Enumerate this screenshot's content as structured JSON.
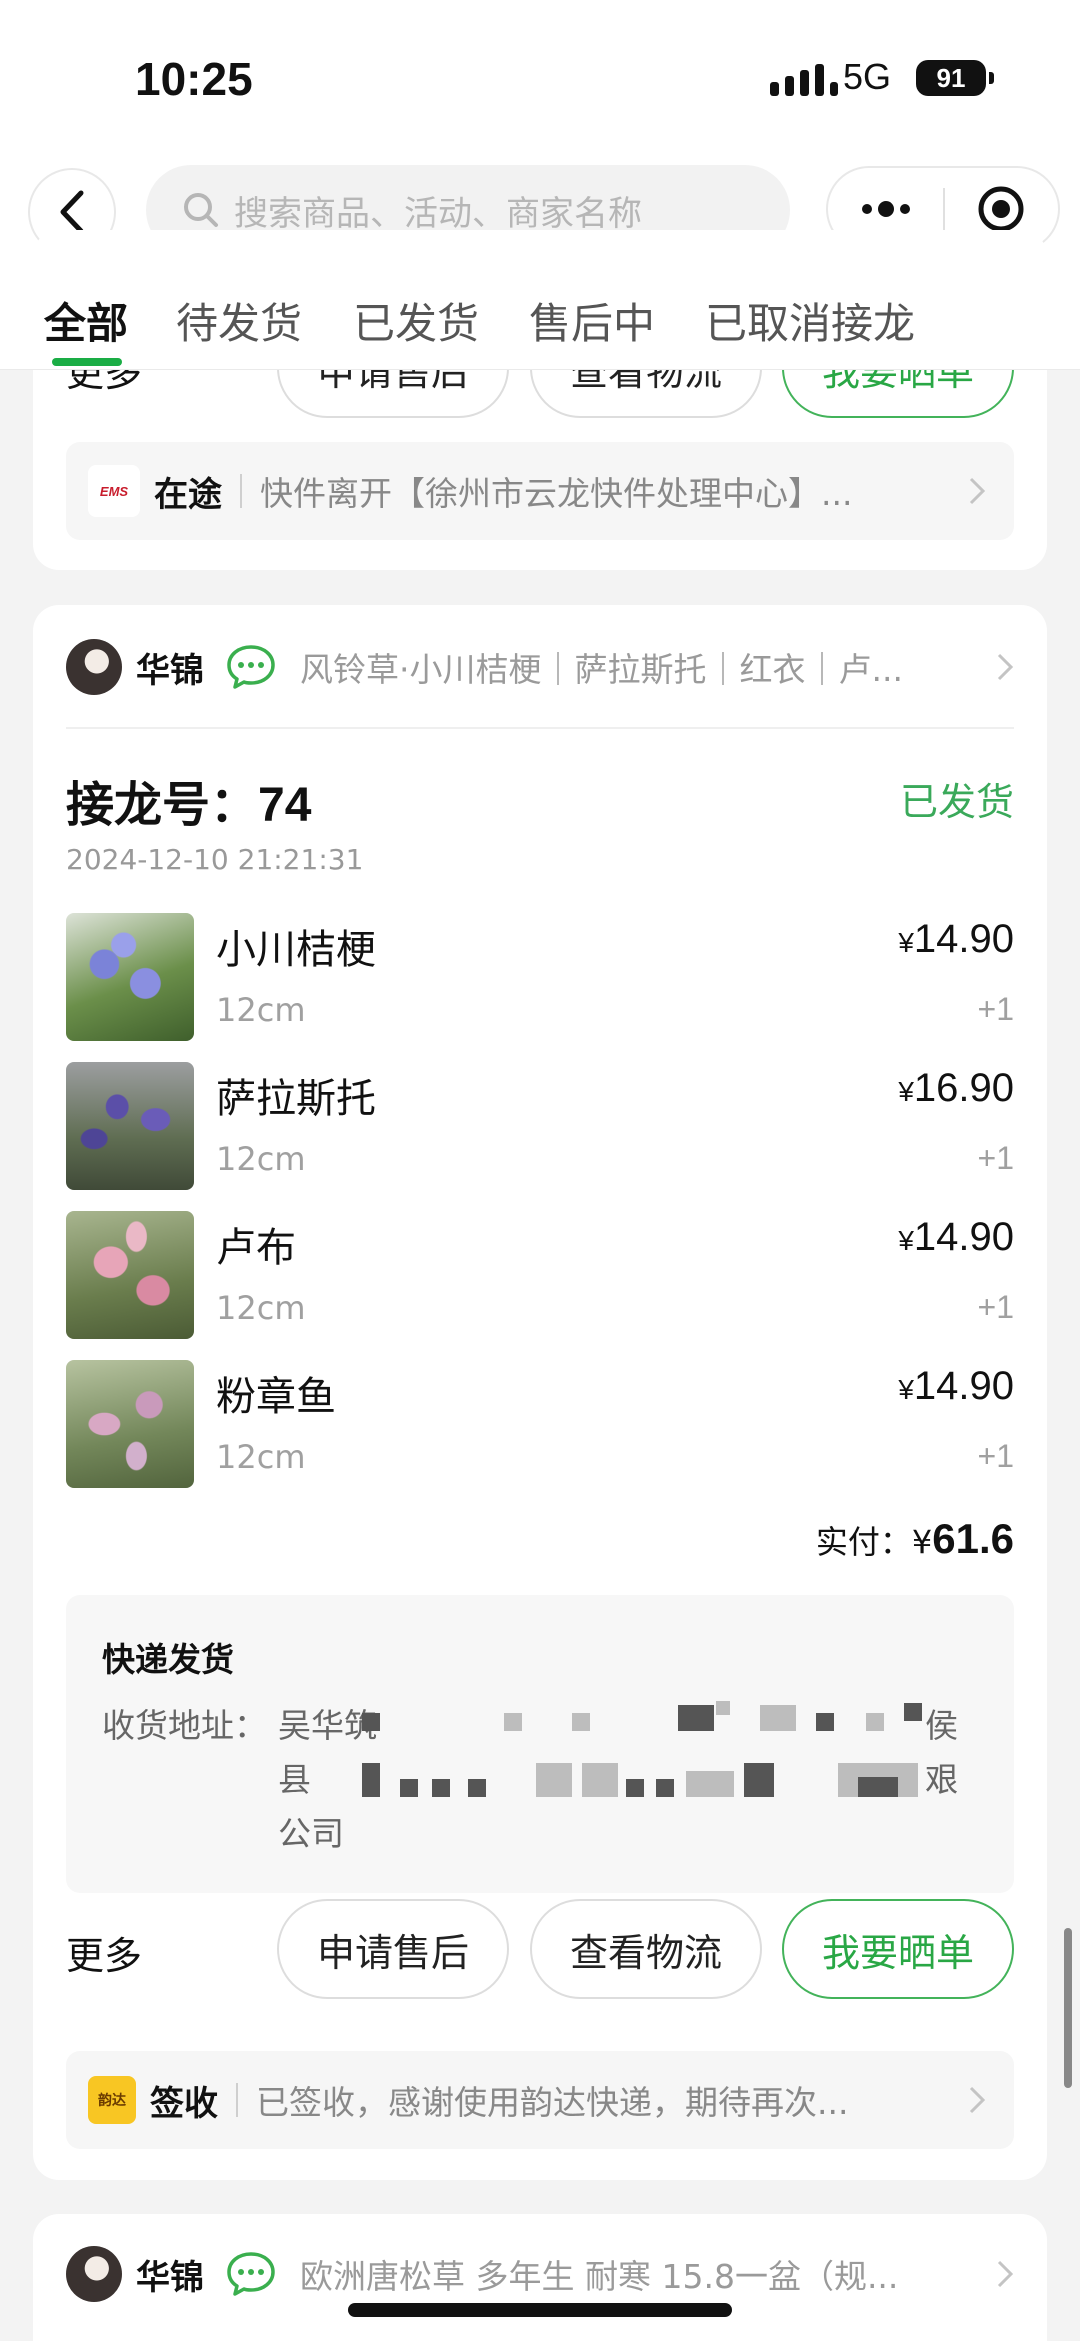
{
  "status": {
    "time": "10:25",
    "network": "5G",
    "battery": "91"
  },
  "search": {
    "placeholder": "搜索商品、活动、商家名称"
  },
  "tabs": [
    "全部",
    "待发货",
    "已发货",
    "售后中",
    "已取消接龙"
  ],
  "top_card": {
    "more_label": "更多",
    "buttons": [
      "申请售后",
      "查看物流",
      "我要晒单"
    ],
    "tracking": {
      "carrier_icon": "EMS",
      "status": "在途",
      "text": "快件离开【徐州市云龙快件处理中心】..."
    }
  },
  "order": {
    "shop_name": "华锦",
    "shop_desc": "风铃草·小川桔梗｜萨拉斯托｜红衣｜卢...",
    "order_label": "接龙号：",
    "order_number": "74",
    "status": "已发货",
    "date": "2024-12-10 21:21:31",
    "items": [
      {
        "name": "小川桔梗",
        "spec": "12cm",
        "currency": "¥",
        "price": "14.90",
        "qty": "+1"
      },
      {
        "name": "萨拉斯托",
        "spec": "12cm",
        "currency": "¥",
        "price": "16.90",
        "qty": "+1"
      },
      {
        "name": "卢布",
        "spec": "12cm",
        "currency": "¥",
        "price": "14.90",
        "qty": "+1"
      },
      {
        "name": "粉章鱼",
        "spec": "12cm",
        "currency": "¥",
        "price": "14.90",
        "qty": "+1"
      }
    ],
    "total_label": "实付：",
    "total_currency": "¥",
    "total_amount": "61.6",
    "shipping": {
      "title": "快递发货",
      "address_label": "收货地址：",
      "address_line1_start": "吴华筑",
      "address_line1_end": "侯",
      "address_line2_start": "县",
      "address_line2_end": "艰",
      "address_line3": "公司"
    },
    "more_label": "更多",
    "buttons": [
      "申请售后",
      "查看物流",
      "我要晒单"
    ],
    "tracking": {
      "carrier_icon": "韵达",
      "status": "签收",
      "text": "已签收，感谢使用韵达快递，期待再次..."
    }
  },
  "next_order": {
    "shop_name": "华锦",
    "shop_desc": "欧洲唐松草 多年生 耐寒 15.8一盆（规..."
  },
  "colors": {
    "accent": "#29a745",
    "tab_indicator": "#1aad45"
  }
}
